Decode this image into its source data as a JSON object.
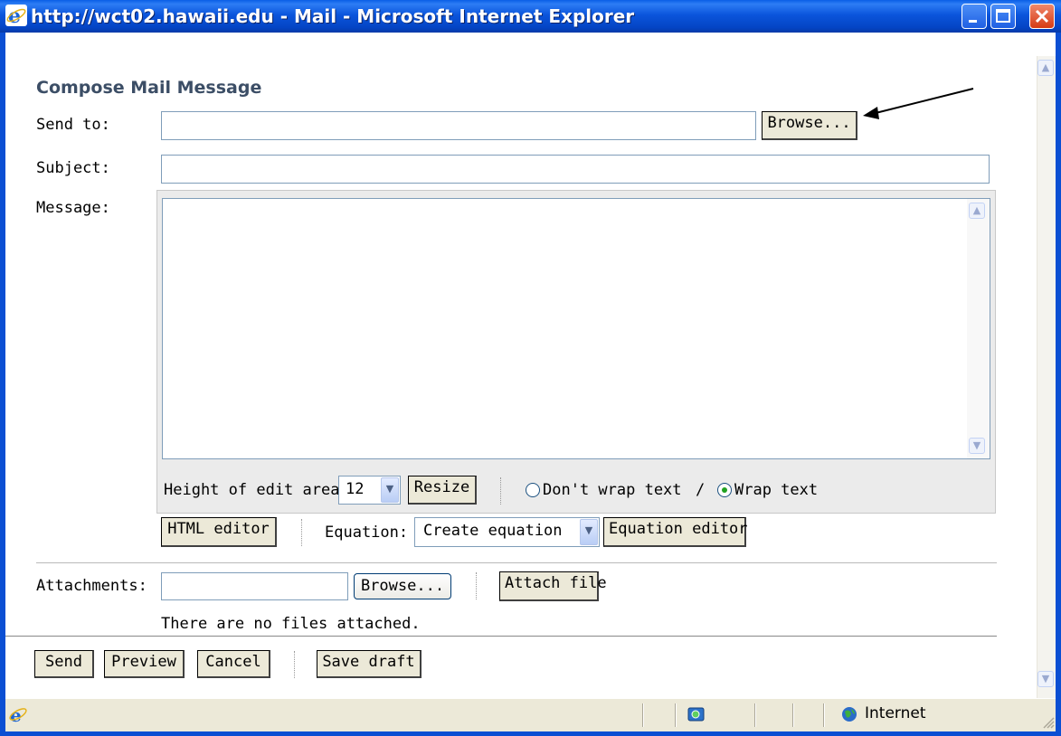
{
  "window": {
    "title": "http://wct02.hawaii.edu - Mail - Microsoft Internet Explorer"
  },
  "form": {
    "heading": "Compose Mail Message",
    "send_to_label": "Send to:",
    "send_to_value": "",
    "browse_recipients_label": "Browse...",
    "subject_label": "Subject:",
    "subject_value": "",
    "message_label": "Message:",
    "message_value": "",
    "height_label": "Height of edit area:",
    "height_value": "12",
    "resize_label": "Resize",
    "wrap_options": {
      "dont_wrap": "Don't wrap text",
      "separator": "/",
      "wrap": "Wrap text",
      "selected": "wrap"
    },
    "html_editor_label": "HTML editor",
    "equation_label": "Equation:",
    "equation_value": "Create equation",
    "equation_editor_label": "Equation editor",
    "attachments_label": "Attachments:",
    "attachments_value": "",
    "browse_file_label": "Browse...",
    "attach_file_label": "Attach file",
    "no_files_text": "There are no files attached.",
    "send_label": "Send",
    "preview_label": "Preview",
    "cancel_label": "Cancel",
    "save_draft_label": "Save draft"
  },
  "statusbar": {
    "zone": "Internet"
  },
  "icons": {
    "page": "ie-icon",
    "minimize": "minimize-icon",
    "maximize": "maximize-icon",
    "close": "close-icon",
    "arrow": "annotation-arrow-icon"
  },
  "colors": {
    "titlebar": "#0b55dc",
    "close_button": "#d63a14",
    "heading": "#3c4e66",
    "radio_selected": "#21a121"
  }
}
